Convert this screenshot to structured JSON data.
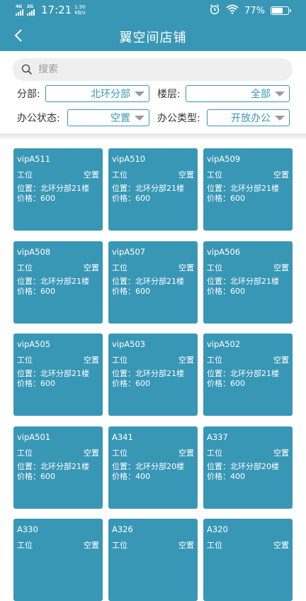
{
  "status_bar": {
    "network_1": "4G",
    "network_2": "2G",
    "time": "17:21",
    "speed_value": "1.90",
    "speed_unit": "KB/s",
    "battery": "77%",
    "battery_level": 0.77,
    "icons": [
      "alarm-icon",
      "wifi-icon",
      "battery-icon"
    ]
  },
  "title_bar": {
    "back_icon": "chevron-left-icon",
    "title": "翼空间店铺"
  },
  "search": {
    "placeholder": "搜索",
    "value": ""
  },
  "filters": {
    "branch": {
      "label": "分部:",
      "value": "北环分部"
    },
    "floor": {
      "label": "楼层:",
      "value": "全部"
    },
    "status": {
      "label": "办公状态:",
      "value": "空置"
    },
    "type": {
      "label": "办公类型:",
      "value": "开放办公"
    }
  },
  "colors": {
    "primary": "#3997b6",
    "search_bg": "#efefef"
  },
  "cards": [
    {
      "code": "vipA511",
      "kind": "工位",
      "state": "空置",
      "location": "位置：北环分部21楼",
      "price": "价格：600"
    },
    {
      "code": "vipA510",
      "kind": "工位",
      "state": "空置",
      "location": "位置：北环分部21楼",
      "price": "价格：600"
    },
    {
      "code": "vipA509",
      "kind": "工位",
      "state": "空置",
      "location": "位置：北环分部21楼",
      "price": "价格：600"
    },
    {
      "code": "vipA508",
      "kind": "工位",
      "state": "空置",
      "location": "位置：北环分部21楼",
      "price": "价格：600"
    },
    {
      "code": "vipA507",
      "kind": "工位",
      "state": "空置",
      "location": "位置：北环分部21楼",
      "price": "价格：600"
    },
    {
      "code": "vipA506",
      "kind": "工位",
      "state": "空置",
      "location": "位置：北环分部21楼",
      "price": "价格：600"
    },
    {
      "code": "vipA505",
      "kind": "工位",
      "state": "空置",
      "location": "位置：北环分部21楼",
      "price": "价格：600"
    },
    {
      "code": "vipA503",
      "kind": "工位",
      "state": "空置",
      "location": "位置：北环分部21楼",
      "price": "价格：600"
    },
    {
      "code": "vipA502",
      "kind": "工位",
      "state": "空置",
      "location": "位置：北环分部21楼",
      "price": "价格：600"
    },
    {
      "code": "vipA501",
      "kind": "工位",
      "state": "空置",
      "location": "位置：北环分部21楼",
      "price": "价格：600"
    },
    {
      "code": "A341",
      "kind": "工位",
      "state": "空置",
      "location": "位置：北环分部20楼",
      "price": "价格：400"
    },
    {
      "code": "A337",
      "kind": "工位",
      "state": "空置",
      "location": "位置：北环分部20楼",
      "price": "价格：400"
    },
    {
      "code": "A330",
      "kind": "工位",
      "state": "空置",
      "location": "",
      "price": ""
    },
    {
      "code": "A326",
      "kind": "工位",
      "state": "空置",
      "location": "",
      "price": ""
    },
    {
      "code": "A320",
      "kind": "工位",
      "state": "空置",
      "location": "",
      "price": ""
    }
  ]
}
